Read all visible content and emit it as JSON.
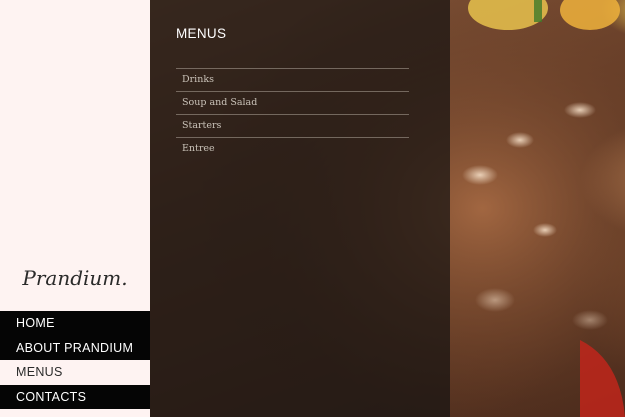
{
  "brand": {
    "logo_text": "Prandium."
  },
  "nav": {
    "items": [
      {
        "label": "HOME",
        "active": false
      },
      {
        "label": "ABOUT PRANDIUM",
        "active": false
      },
      {
        "label": "MENUS",
        "active": true
      },
      {
        "label": "CONTACTS",
        "active": false
      }
    ]
  },
  "panel": {
    "title": "MENUS",
    "items": [
      {
        "label": "Drinks"
      },
      {
        "label": "Soup and Salad"
      },
      {
        "label": "Starters"
      },
      {
        "label": "Entree"
      }
    ]
  },
  "colors": {
    "sidebar_bg": "#fef3f2",
    "nav_bg": "#050505",
    "nav_text": "#ffffff",
    "panel_overlay": "rgba(22,20,18,0.72)",
    "menu_text": "#c9c2b8"
  },
  "background": {
    "image": "steak-photo"
  }
}
